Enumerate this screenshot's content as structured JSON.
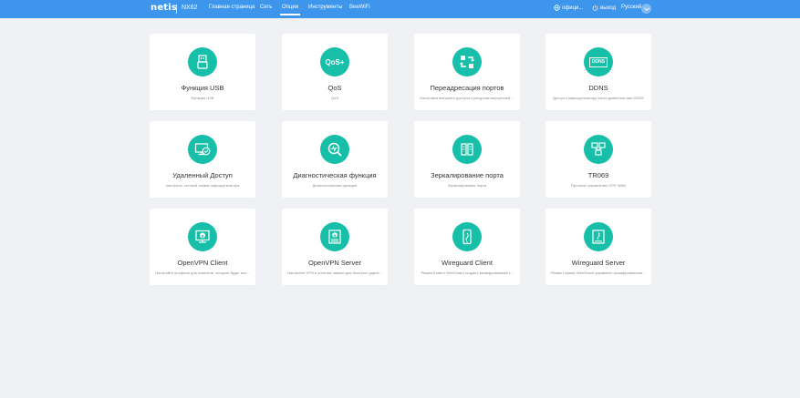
{
  "header": {
    "logo": "netis",
    "model": "NX62",
    "nav": [
      {
        "label": "Главная страница"
      },
      {
        "label": "Сеть"
      },
      {
        "label": "Опции"
      },
      {
        "label": "Инструменты"
      },
      {
        "label": "BeeWiFi"
      }
    ],
    "active_nav": "Опции",
    "official_label": "офици...",
    "logout_label": "выход",
    "language": "Русский"
  },
  "cards": [
    {
      "title": "Функция USB",
      "desc": "Функция USB",
      "icon": "usb-icon"
    },
    {
      "title": "QoS",
      "desc": "QoS",
      "icon": "qos-icon",
      "icon_text": "QoS+"
    },
    {
      "title": "Переадресация портов",
      "desc": "Настройка внешнего доступа к ресурсам внутренней ...",
      "icon": "port-forward-icon"
    },
    {
      "title": "DDNS",
      "desc": "Доступ к маршрутизатору через доменное имя DDNS",
      "icon": "ddns-icon",
      "icon_text": "DDNS"
    },
    {
      "title": "Удаленный Доступ",
      "desc": "настроить сетевой сервис маршрутизатора",
      "icon": "remote-access-icon"
    },
    {
      "title": "Диагностическая функция",
      "desc": "Диагностическая функция",
      "icon": "diagnostic-icon"
    },
    {
      "title": "Зеркалирование порта",
      "desc": "Зеркалирование порта",
      "icon": "port-mirror-icon"
    },
    {
      "title": "TR069",
      "desc": "Протокол управления CPE WAN",
      "icon": "tr069-icon"
    },
    {
      "title": "OpenVPN Client",
      "desc": "Настройте профили для клиентов, которые будут исп...",
      "icon": "openvpn-client-icon"
    },
    {
      "title": "OpenVPN Server",
      "desc": "Настройте VPN и учетные записи для быстрого удале...",
      "icon": "openvpn-server-icon"
    },
    {
      "title": "Wireguard Client",
      "desc": "Режим Клиент WireGuard создает зашифрованный т...",
      "icon": "wireguard-client-icon"
    },
    {
      "title": "Wireguard Server",
      "desc": "Режим Сервер WireGuard управляет зашифрованным ...",
      "icon": "wireguard-server-icon"
    }
  ],
  "colors": {
    "header_bg": "#3d95ec",
    "icon_bg": "#17bfa9",
    "page_bg": "#eff1f5"
  }
}
